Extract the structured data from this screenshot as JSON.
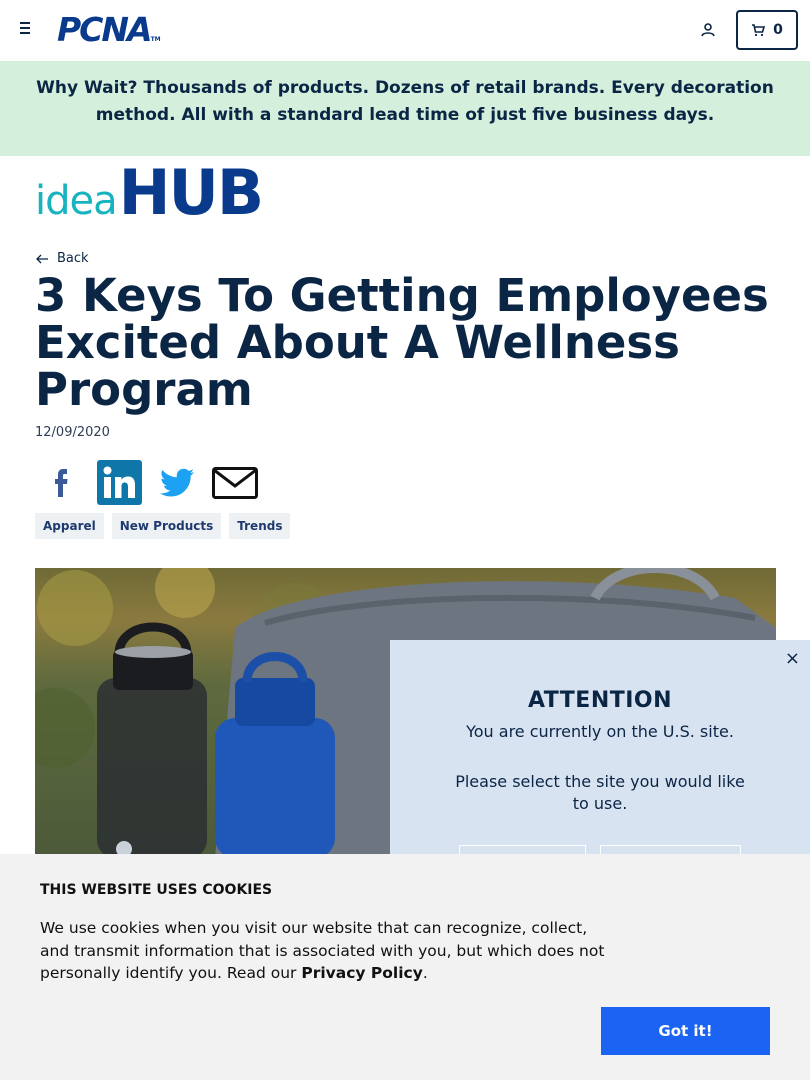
{
  "header": {
    "logo_text": "PCNA",
    "logo_tm": "TM",
    "cart_count": "0"
  },
  "banner": {
    "lead": "Why Wait?",
    "text": " Thousands of products. Dozens of retail brands. Every decoration method. All with a standard lead time of just five business days."
  },
  "brand": {
    "idea": "idea",
    "hub": "HUB"
  },
  "article": {
    "back_label": "Back",
    "title": "3 Keys To Getting Employees Excited About A Wellness Program",
    "date": "12/09/2020",
    "share_icons": [
      "facebook-icon",
      "linkedin-icon",
      "twitter-icon",
      "email-icon"
    ],
    "tags": [
      "Apparel",
      "New Products",
      "Trends"
    ]
  },
  "modal": {
    "title": "ATTENTION",
    "line1": "You are currently on the U.S. site.",
    "line2": "Please select the site you would like to use.",
    "close": "×"
  },
  "cookie": {
    "title": "THIS WEBSITE USES COOKIES",
    "text": "We use cookies when you visit our website that can recognize, collect, and transmit information that is associated with you, but which does not personally identify you. Read our ",
    "link": "Privacy Policy",
    "end": ".",
    "button": "Got it!"
  },
  "colors": {
    "navy": "#0b2545",
    "brand_blue": "#0a3a8c",
    "teal": "#17b4c0",
    "banner_bg": "#d4f0dc",
    "modal_bg": "#d8e3f2",
    "button_blue": "#1b63f2"
  }
}
